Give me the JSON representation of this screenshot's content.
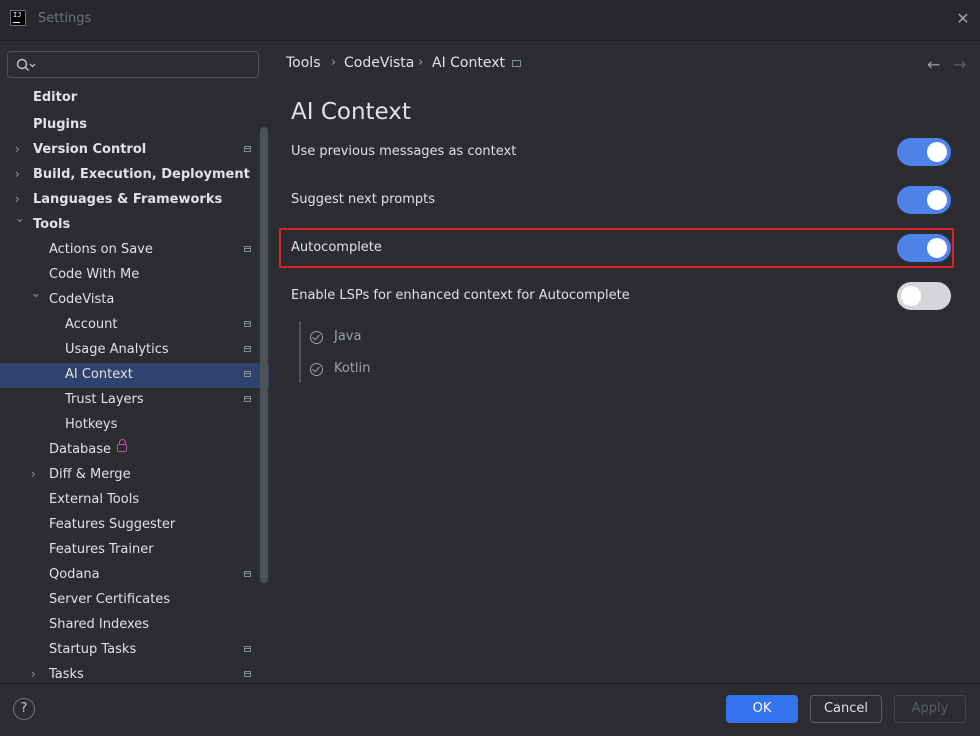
{
  "window": {
    "title": "Settings",
    "app_icon_text": "IJ",
    "close_glyph": "✕"
  },
  "search": {
    "placeholder": "",
    "value": ""
  },
  "sidebar": {
    "items": [
      {
        "label": "Editor"
      },
      {
        "label": "Plugins"
      },
      {
        "label": "Version Control"
      },
      {
        "label": "Build, Execution, Deployment"
      },
      {
        "label": "Languages & Frameworks"
      },
      {
        "label": "Tools"
      },
      {
        "label": "Actions on Save"
      },
      {
        "label": "Code With Me"
      },
      {
        "label": "CodeVista"
      },
      {
        "label": "Account"
      },
      {
        "label": "Usage Analytics"
      },
      {
        "label": "AI Context"
      },
      {
        "label": "Trust Layers"
      },
      {
        "label": "Hotkeys"
      },
      {
        "label": "Database"
      },
      {
        "label": "Diff & Merge"
      },
      {
        "label": "External Tools"
      },
      {
        "label": "Features Suggester"
      },
      {
        "label": "Features Trainer"
      },
      {
        "label": "Qodana"
      },
      {
        "label": "Server Certificates"
      },
      {
        "label": "Shared Indexes"
      },
      {
        "label": "Startup Tasks"
      },
      {
        "label": "Tasks"
      }
    ],
    "selected": "AI Context"
  },
  "breadcrumb": {
    "items": [
      "Tools",
      "CodeVista",
      "AI Context"
    ],
    "separator": "›"
  },
  "nav": {
    "back": "←",
    "forward": "→"
  },
  "page": {
    "title": "AI Context",
    "settings": [
      {
        "label": "Use previous messages as context",
        "enabled": true
      },
      {
        "label": "Suggest next prompts",
        "enabled": true
      },
      {
        "label": "Autocomplete",
        "enabled": true
      },
      {
        "label": "Enable LSPs for enhanced context for Autocomplete",
        "enabled": false
      }
    ],
    "languages": [
      "Java",
      "Kotlin"
    ]
  },
  "footer": {
    "help": "?",
    "ok": "OK",
    "cancel": "Cancel",
    "apply": "Apply"
  },
  "colors": {
    "accent": "#3574f0",
    "toggle_on": "#4d83e9",
    "selection": "#2e436e",
    "highlight": "#e02020"
  }
}
